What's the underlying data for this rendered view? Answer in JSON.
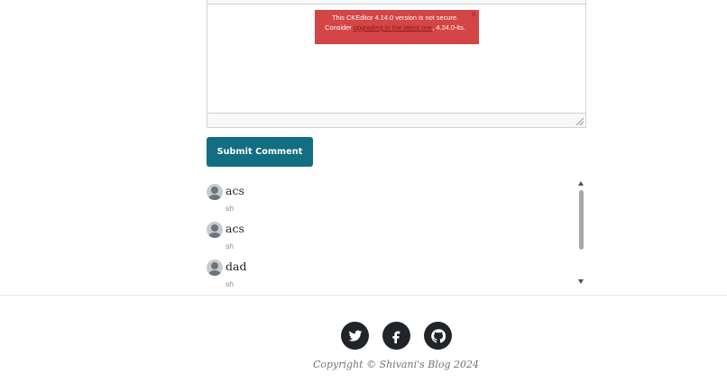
{
  "editor": {
    "warning": {
      "line1": "This CKEditor 4.14.0 version is not secure.",
      "consider": "Consider ",
      "link_text": "upgrading to the latest one",
      "version": ", 4.24.0-lts.",
      "close": "×"
    }
  },
  "form": {
    "submit_label": "Submit Comment"
  },
  "comments": [
    {
      "name": "acs",
      "text": "sh"
    },
    {
      "name": "acs",
      "text": "sh"
    },
    {
      "name": "dad",
      "text": "sh"
    }
  ],
  "footer": {
    "social": [
      "twitter-icon",
      "facebook-icon",
      "github-icon"
    ],
    "copyright": "Copyright © Shivani's Blog 2024"
  },
  "colors": {
    "primary_button": "#126e82",
    "warning_bg": "#d44545",
    "social_circle": "#212529"
  }
}
